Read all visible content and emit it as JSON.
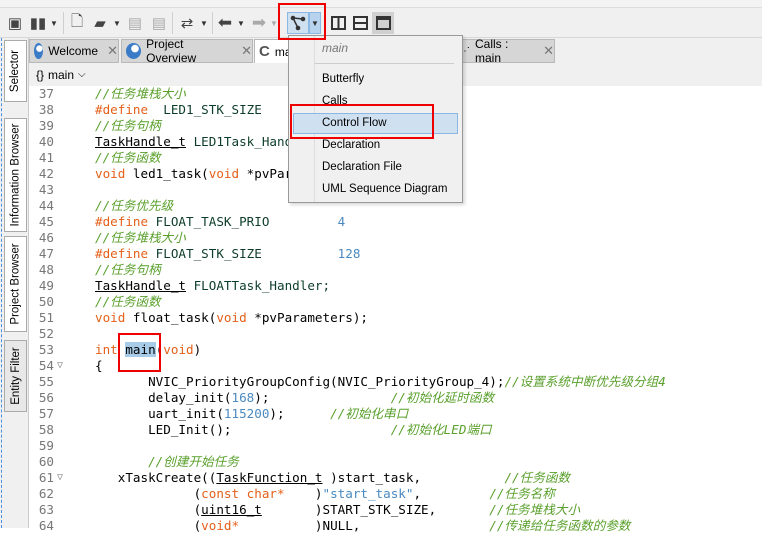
{
  "toolbar": {
    "icons": [
      "new-project-icon",
      "book-icon",
      "new-file-icon",
      "open-folder-icon",
      "save-icon",
      "save-all-icon",
      "compare-icon",
      "back-icon",
      "forward-icon",
      "graph-icon",
      "split-vertical-icon",
      "split-horizontal-icon",
      "single-pane-icon"
    ]
  },
  "sidebar": {
    "tabs": [
      {
        "label": "Selector"
      },
      {
        "label": "Information Browser"
      },
      {
        "label": "Project Browser"
      },
      {
        "label": "Entity Filter"
      }
    ]
  },
  "tabs": [
    {
      "label": "Welcome"
    },
    {
      "label": "Project Overview"
    },
    {
      "label": "main"
    },
    {
      "label": "Calls : main"
    }
  ],
  "breadcrumb": {
    "icon": "{}",
    "label": "main"
  },
  "menu": {
    "header": "main",
    "items": [
      {
        "label": "Butterfly"
      },
      {
        "label": "Calls"
      },
      {
        "label": "Control Flow",
        "selected": true
      },
      {
        "label": "Declaration"
      },
      {
        "label": "Declaration File"
      },
      {
        "label": "UML Sequence Diagram"
      }
    ]
  },
  "colors": {
    "keyword": "#e4601a",
    "comment": "#5aa02c",
    "number": "#4a8ac0",
    "highlight": "#a8cce8",
    "annotation": "#ee0000",
    "menu_selected": "#cfe0f1"
  },
  "code": [
    {
      "n": "37",
      "t": [
        [
          "cm",
          "//任务堆栈大小"
        ]
      ]
    },
    {
      "n": "38",
      "t": [
        [
          "kw",
          "#define"
        ],
        [
          "",
          "  "
        ],
        [
          "mac",
          "LED1_STK_SIZE"
        ]
      ]
    },
    {
      "n": "39",
      "t": [
        [
          "cm",
          "//任务句柄"
        ]
      ]
    },
    {
      "n": "40",
      "t": [
        [
          "ty",
          "TaskHandle_t"
        ],
        [
          "",
          " "
        ],
        [
          "mac",
          "LED1Task_Handler;"
        ]
      ]
    },
    {
      "n": "41",
      "t": [
        [
          "cm",
          "//任务函数"
        ]
      ]
    },
    {
      "n": "42",
      "t": [
        [
          "kw",
          "void"
        ],
        [
          "",
          " led1_task("
        ],
        [
          "kw",
          "void"
        ],
        [
          "",
          " *pvParameters);"
        ]
      ]
    },
    {
      "n": "43",
      "t": []
    },
    {
      "n": "44",
      "t": [
        [
          "cm",
          "//任务优先级"
        ]
      ]
    },
    {
      "n": "45",
      "t": [
        [
          "kw",
          "#define"
        ],
        [
          "",
          " "
        ],
        [
          "mac",
          "FLOAT_TASK_PRIO"
        ],
        [
          "",
          "         "
        ],
        [
          "num",
          "4"
        ]
      ]
    },
    {
      "n": "46",
      "t": [
        [
          "cm",
          "//任务堆栈大小"
        ]
      ]
    },
    {
      "n": "47",
      "t": [
        [
          "kw",
          "#define"
        ],
        [
          "",
          " "
        ],
        [
          "mac",
          "FLOAT_STK_SIZE"
        ],
        [
          "",
          "          "
        ],
        [
          "num",
          "128"
        ]
      ]
    },
    {
      "n": "48",
      "t": [
        [
          "cm",
          "//任务句柄"
        ]
      ]
    },
    {
      "n": "49",
      "t": [
        [
          "ty",
          "TaskHandle_t"
        ],
        [
          "",
          " "
        ],
        [
          "mac",
          "FLOATTask_Handler;"
        ]
      ]
    },
    {
      "n": "50",
      "t": [
        [
          "cm",
          "//任务函数"
        ]
      ]
    },
    {
      "n": "51",
      "t": [
        [
          "kw",
          "void"
        ],
        [
          "",
          " float_task("
        ],
        [
          "kw",
          "void"
        ],
        [
          "",
          " *pvParameters);"
        ]
      ]
    },
    {
      "n": "52",
      "t": []
    },
    {
      "n": "53",
      "t": [
        [
          "kw",
          "int"
        ],
        [
          "",
          " "
        ],
        [
          "hl",
          "main"
        ],
        [
          "",
          "("
        ],
        [
          "kw",
          "void"
        ],
        [
          "",
          ")"
        ]
      ],
      "fold": false
    },
    {
      "n": "54",
      "t": [
        [
          "",
          "{"
        ]
      ],
      "fold": true
    },
    {
      "n": "55",
      "t": [
        [
          "",
          "       NVIC_PriorityGroupConfig(NVIC_PriorityGroup_4);"
        ],
        [
          "cm",
          "//设置系统中断优先级分组4"
        ]
      ]
    },
    {
      "n": "56",
      "t": [
        [
          "",
          "       delay_init("
        ],
        [
          "num",
          "168"
        ],
        [
          "",
          ");                "
        ],
        [
          "cm",
          "//初始化延时函数"
        ]
      ]
    },
    {
      "n": "57",
      "t": [
        [
          "",
          "       uart_init("
        ],
        [
          "num",
          "115200"
        ],
        [
          "",
          ");      "
        ],
        [
          "cm",
          "//初始化串口"
        ]
      ]
    },
    {
      "n": "58",
      "t": [
        [
          "",
          "       LED_Init();                     "
        ],
        [
          "cm",
          "//初始化LED端口"
        ]
      ]
    },
    {
      "n": "59",
      "t": []
    },
    {
      "n": "60",
      "t": [
        [
          "cm",
          "       //创建开始任务"
        ]
      ]
    },
    {
      "n": "61",
      "t": [
        [
          "",
          "   xTaskCreate(("
        ],
        [
          "ty",
          "TaskFunction_t"
        ],
        [
          "",
          " )start_task,           "
        ],
        [
          "cm",
          "//任务函数"
        ]
      ],
      "fold": true
    },
    {
      "n": "62",
      "t": [
        [
          "",
          "             ("
        ],
        [
          "kw",
          "const char*"
        ],
        [
          "",
          "    )"
        ],
        [
          "str",
          "\"start_task\""
        ],
        [
          "",
          ",         "
        ],
        [
          "cm",
          "//任务名称"
        ]
      ]
    },
    {
      "n": "63",
      "t": [
        [
          "",
          "             ("
        ],
        [
          "ty",
          "uint16_t"
        ],
        [
          "",
          "       )START_STK_SIZE,       "
        ],
        [
          "cm",
          "//任务堆栈大小"
        ]
      ]
    },
    {
      "n": "64",
      "t": [
        [
          "",
          "             ("
        ],
        [
          "kw",
          "void*"
        ],
        [
          "",
          "          )NULL,                 "
        ],
        [
          "cm",
          "//传递给任务函数的参数"
        ]
      ]
    }
  ]
}
